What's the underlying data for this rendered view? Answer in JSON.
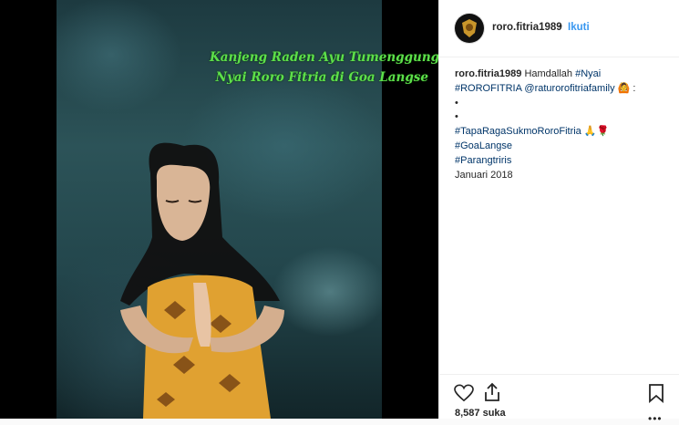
{
  "post": {
    "image_overlay": {
      "line1": "Kanjeng Raden Ayu Tumenggung",
      "line2": "Nyai Roro Fitria di Goa Langse"
    }
  },
  "header": {
    "username": "roro.fitria1989",
    "separator": "•",
    "follow_label": "Ikuti"
  },
  "caption": {
    "username": "roro.fitria1989",
    "text_start": "Hamdallah ",
    "tag_nyai": "#Nyai",
    "tag_rorofitria": "#ROROFITRIA",
    "mention": "@raturorofitriafamily",
    "emoji_1": "🙆",
    "colon": " :",
    "bullet_1": "•",
    "bullet_2": "•",
    "tag_taparaga": "#TapaRagaSukmoRoroFitria",
    "emoji_2": "🙏🌹",
    "tag_goalangse": "#GoaLangse",
    "tag_parangtritis": "#Parangtriris",
    "date_text": "Januari 2018"
  },
  "actions": {
    "likes": "8,587 suka",
    "more": "•••"
  },
  "icons": {
    "like": "heart-icon",
    "share": "share-icon",
    "save": "bookmark-icon",
    "more": "more-icon"
  },
  "colors": {
    "follow": "#3897f0",
    "hashtag": "#003569",
    "overlay_text": "#5de04a"
  }
}
